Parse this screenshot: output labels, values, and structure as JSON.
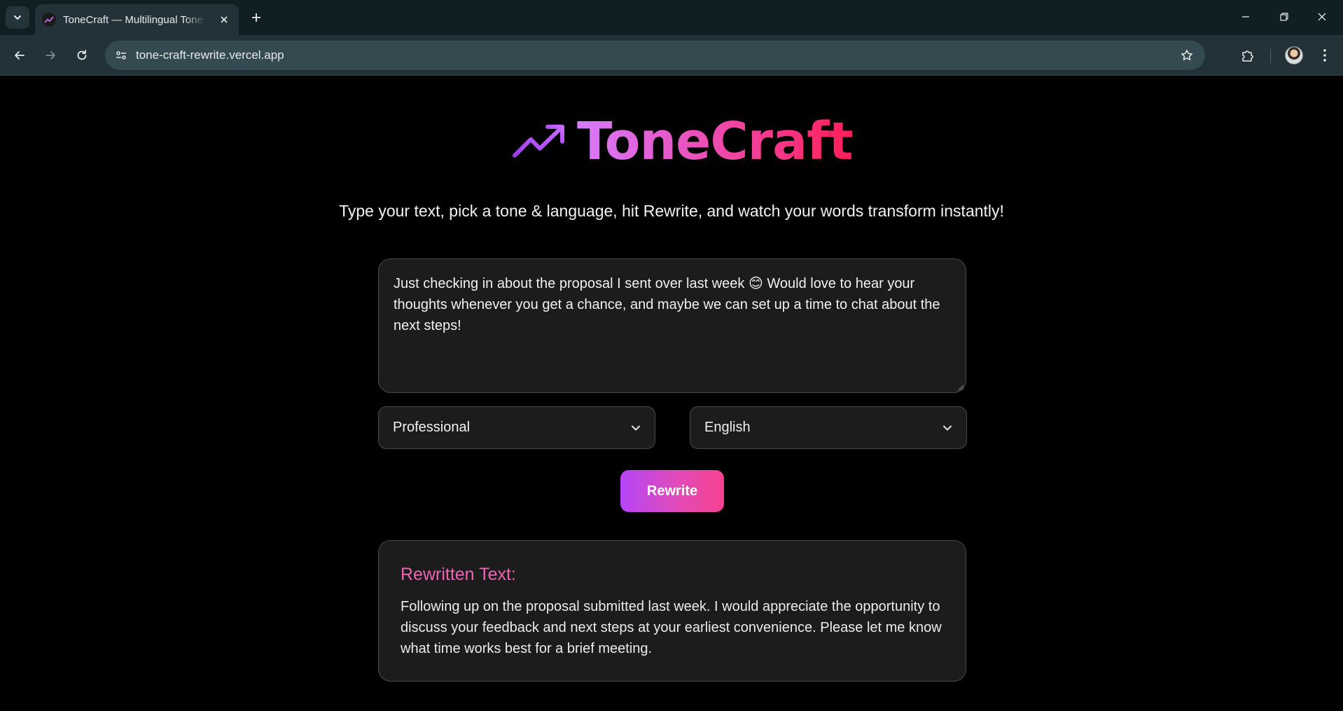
{
  "browser": {
    "tab_title": "ToneCraft — Multilingual Tone Rewriter",
    "url": "tone-craft-rewrite.vercel.app"
  },
  "app": {
    "name": "ToneCraft",
    "tagline": "Type your text, pick a tone & language, hit Rewrite, and watch your words transform instantly!",
    "input_text": "Just checking in about the proposal I sent over last week 😊 Would love to hear your thoughts whenever you get a chance, and maybe we can set up a time to chat about the next steps!",
    "tone_select": {
      "selected": "Professional"
    },
    "language_select": {
      "selected": "English"
    },
    "rewrite_label": "Rewrite",
    "result": {
      "title": "Rewritten Text:",
      "text": "Following up on the proposal submitted last week. I would appreciate the opportunity to discuss your feedback and next steps at your earliest convenience. Please let me know what time works best for a brief meeting."
    }
  },
  "colors": {
    "brand_gradient_start": "#d67bff",
    "brand_gradient_end": "#ff1f58",
    "result_title": "#f062b4",
    "page_bg": "#000000",
    "card_bg": "#1c1c1c"
  },
  "icons": {
    "logo": "trending-up-icon",
    "tab_favicon": "trending-up-icon",
    "select_caret": "chevron-down-icon"
  }
}
